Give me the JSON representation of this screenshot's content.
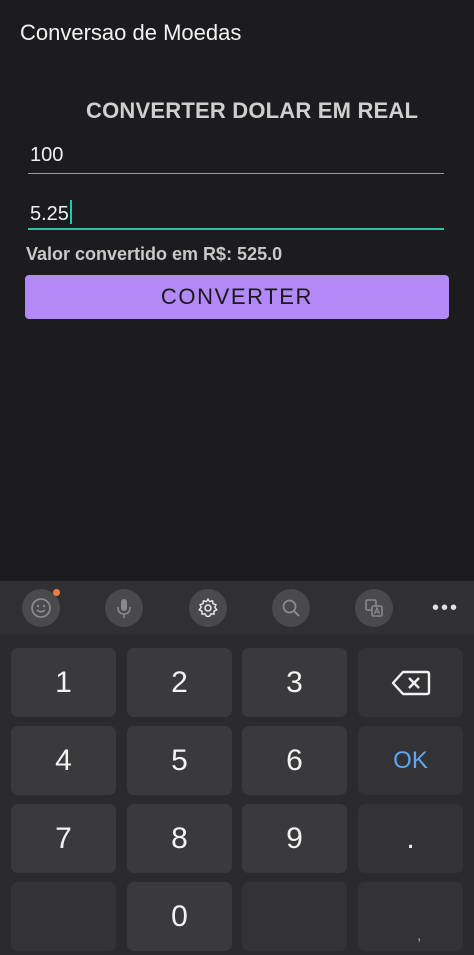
{
  "app": {
    "title": "Conversao de Moedas"
  },
  "form": {
    "heading": "CONVERTER DOLAR EM REAL",
    "amount_value": "100",
    "rate_value": "5.25",
    "result_text": "Valor convertido em R$: 525.0",
    "button_label": "CONVERTER"
  },
  "keyboard": {
    "toolbar": {
      "icons": [
        "emoji-icon",
        "microphone-icon",
        "settings-icon",
        "search-icon",
        "translate-icon",
        "more-icon"
      ],
      "more_label": "•••"
    },
    "keys": {
      "k1": "1",
      "k2": "2",
      "k3": "3",
      "k4": "4",
      "k5": "5",
      "k6": "6",
      "k7": "7",
      "k8": "8",
      "k9": "9",
      "k0": "0",
      "dot": ".",
      "ok": "OK",
      "comma": ","
    }
  },
  "colors": {
    "background": "#1c1c1e",
    "accent_button": "#b388f7",
    "focus_underline": "#2cc2b0",
    "ok_key": "#5ea6f5",
    "notification_dot": "#f07b3f"
  }
}
